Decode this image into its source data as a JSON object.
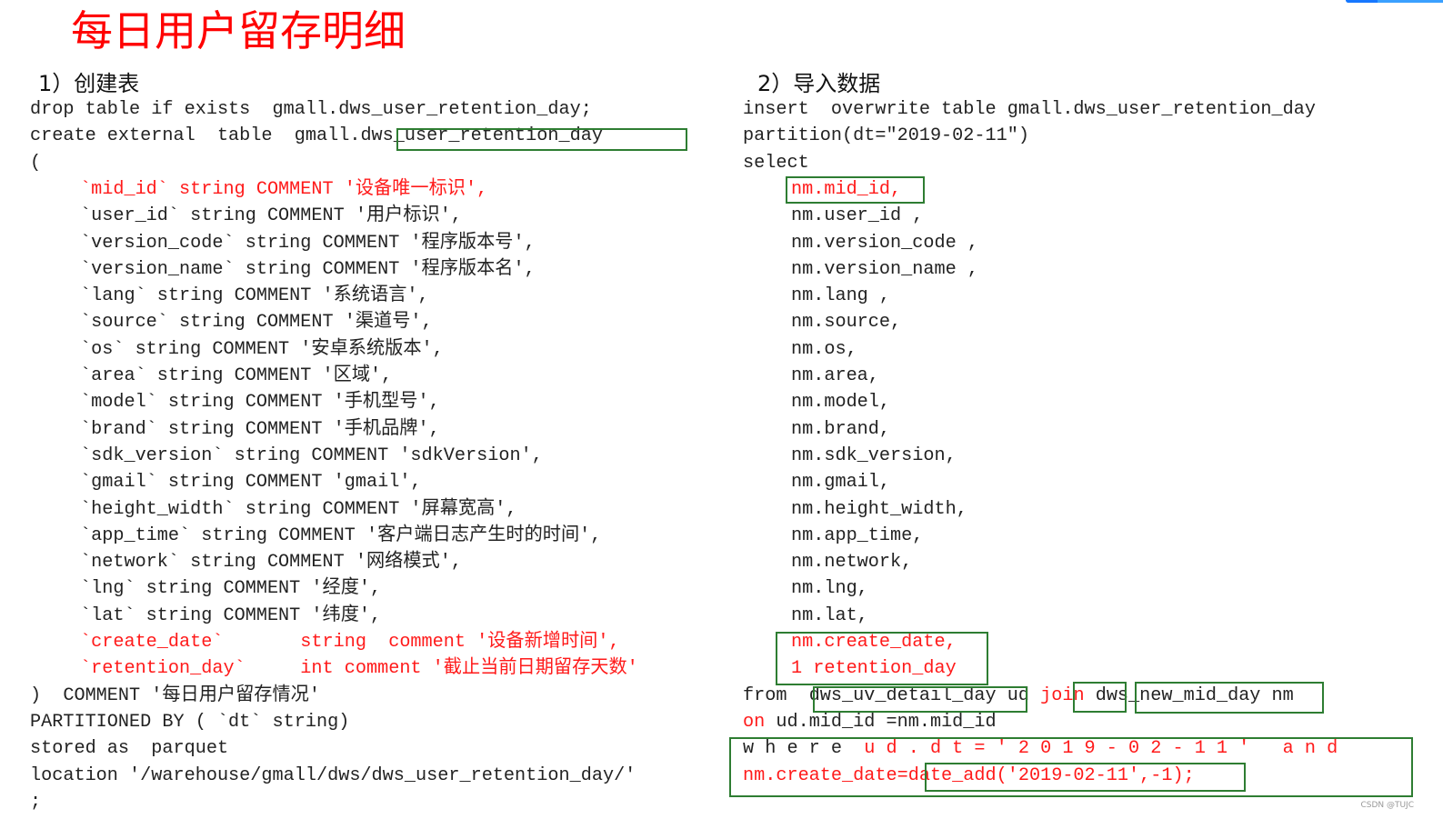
{
  "title": "每日用户留存明细",
  "watermark": "CSDN @TUJC",
  "colors": {
    "highlight_red": "#ff1a1a",
    "box_green": "#2e7d32",
    "title_red": "#ff0000"
  },
  "left": {
    "heading": "1）创建表",
    "lines": [
      {
        "indent": 0,
        "segments": [
          {
            "t": "drop table if exists  gmall.dws_user_retention_day;"
          }
        ]
      },
      {
        "indent": 0,
        "segments": [
          {
            "t": "create external  table  gmall."
          },
          {
            "t": "dws_user_retention_day"
          }
        ]
      },
      {
        "indent": 0,
        "segments": [
          {
            "t": "("
          }
        ]
      },
      {
        "indent": 1,
        "segments": [
          {
            "t": "`mid_id` string COMMENT '设备唯一标识',",
            "red": true
          }
        ]
      },
      {
        "indent": 1,
        "segments": [
          {
            "t": "`user_id` string COMMENT '用户标识',"
          }
        ]
      },
      {
        "indent": 1,
        "segments": [
          {
            "t": "`version_code` string COMMENT '程序版本号',"
          }
        ]
      },
      {
        "indent": 1,
        "segments": [
          {
            "t": "`version_name` string COMMENT '程序版本名',"
          }
        ]
      },
      {
        "indent": 1,
        "segments": [
          {
            "t": "`lang` string COMMENT '系统语言',"
          }
        ]
      },
      {
        "indent": 1,
        "segments": [
          {
            "t": "`source` string COMMENT '渠道号',"
          }
        ]
      },
      {
        "indent": 1,
        "segments": [
          {
            "t": "`os` string COMMENT '安卓系统版本',"
          }
        ]
      },
      {
        "indent": 1,
        "segments": [
          {
            "t": "`area` string COMMENT '区域',"
          }
        ]
      },
      {
        "indent": 1,
        "segments": [
          {
            "t": "`model` string COMMENT '手机型号',"
          }
        ]
      },
      {
        "indent": 1,
        "segments": [
          {
            "t": "`brand` string COMMENT '手机品牌',"
          }
        ]
      },
      {
        "indent": 1,
        "segments": [
          {
            "t": "`sdk_version` string COMMENT 'sdkVersion',"
          }
        ]
      },
      {
        "indent": 1,
        "segments": [
          {
            "t": "`gmail` string COMMENT 'gmail',"
          }
        ]
      },
      {
        "indent": 1,
        "segments": [
          {
            "t": "`height_width` string COMMENT '屏幕宽高',"
          }
        ]
      },
      {
        "indent": 1,
        "segments": [
          {
            "t": "`app_time` string COMMENT '客户端日志产生时的时间',"
          }
        ]
      },
      {
        "indent": 1,
        "segments": [
          {
            "t": "`network` string COMMENT '网络模式',"
          }
        ]
      },
      {
        "indent": 1,
        "segments": [
          {
            "t": "`lng` string COMMENT '经度',"
          }
        ]
      },
      {
        "indent": 1,
        "segments": [
          {
            "t": "`lat` string COMMENT '纬度',"
          }
        ]
      },
      {
        "indent": 1,
        "segments": [
          {
            "t": "`create_date`       string  comment '设备新增时间',",
            "red": true
          }
        ]
      },
      {
        "indent": 1,
        "segments": [
          {
            "t": "`retention_day`     int comment '截止当前日期留存天数'",
            "red": true
          }
        ]
      },
      {
        "indent": 0,
        "segments": [
          {
            "t": ")  COMMENT '每日用户留存情况'"
          }
        ]
      },
      {
        "indent": 0,
        "segments": [
          {
            "t": "PARTITIONED BY ( `dt` string)"
          }
        ]
      },
      {
        "indent": 0,
        "segments": [
          {
            "t": "stored as  parquet"
          }
        ]
      },
      {
        "indent": 0,
        "segments": [
          {
            "t": "location '/warehouse/gmall/dws/dws_user_retention_day/'"
          }
        ]
      },
      {
        "indent": 0,
        "segments": [
          {
            "t": ";"
          }
        ]
      }
    ]
  },
  "right": {
    "heading": "2）导入数据",
    "lines": [
      {
        "indent": 0,
        "segments": [
          {
            "t": "insert  overwrite table gmall.dws_user_retention_day"
          }
        ]
      },
      {
        "indent": 0,
        "segments": [
          {
            "t": "partition(dt=\"2019-02-11\")"
          }
        ]
      },
      {
        "indent": 0,
        "segments": [
          {
            "t": "select"
          }
        ]
      },
      {
        "indent": 1,
        "segments": [
          {
            "t": "nm.mid_id,",
            "red": true
          }
        ]
      },
      {
        "indent": 1,
        "segments": [
          {
            "t": "nm.user_id ,"
          }
        ]
      },
      {
        "indent": 1,
        "segments": [
          {
            "t": "nm.version_code ,"
          }
        ]
      },
      {
        "indent": 1,
        "segments": [
          {
            "t": "nm.version_name ,"
          }
        ]
      },
      {
        "indent": 1,
        "segments": [
          {
            "t": "nm.lang ,"
          }
        ]
      },
      {
        "indent": 1,
        "segments": [
          {
            "t": "nm.source,"
          }
        ]
      },
      {
        "indent": 1,
        "segments": [
          {
            "t": "nm.os,"
          }
        ]
      },
      {
        "indent": 1,
        "segments": [
          {
            "t": "nm.area,"
          }
        ]
      },
      {
        "indent": 1,
        "segments": [
          {
            "t": "nm.model,"
          }
        ]
      },
      {
        "indent": 1,
        "segments": [
          {
            "t": "nm.brand,"
          }
        ]
      },
      {
        "indent": 1,
        "segments": [
          {
            "t": "nm.sdk_version,"
          }
        ]
      },
      {
        "indent": 1,
        "segments": [
          {
            "t": "nm.gmail,"
          }
        ]
      },
      {
        "indent": 1,
        "segments": [
          {
            "t": "nm.height_width,"
          }
        ]
      },
      {
        "indent": 1,
        "segments": [
          {
            "t": "nm.app_time,"
          }
        ]
      },
      {
        "indent": 1,
        "segments": [
          {
            "t": "nm.network,"
          }
        ]
      },
      {
        "indent": 1,
        "segments": [
          {
            "t": "nm.lng,"
          }
        ]
      },
      {
        "indent": 1,
        "segments": [
          {
            "t": "nm.lat,"
          }
        ]
      },
      {
        "indent": 1,
        "segments": [
          {
            "t": "nm.create_date,",
            "red": true
          }
        ]
      },
      {
        "indent": 1,
        "segments": [
          {
            "t": "1 retention_day",
            "red": true
          }
        ]
      },
      {
        "indent": 0,
        "segments": [
          {
            "t": "from  "
          },
          {
            "t": "dws_uv_detail_day"
          },
          {
            "t": " ud "
          },
          {
            "t": "join",
            "red": true
          },
          {
            "t": " "
          },
          {
            "t": "dws_new_mid_day"
          },
          {
            "t": " nm"
          }
        ]
      },
      {
        "indent": 0,
        "segments": [
          {
            "t": "on",
            "red": true
          },
          {
            "t": " ud.mid_id =nm.mid_id"
          }
        ]
      },
      {
        "indent": 0,
        "segments": [
          {
            "t": "w h e r e  "
          },
          {
            "t": "u d . d t = ' 2 0 1 9 - 0 2 - 1 1 '   a n d",
            "red": true
          }
        ]
      },
      {
        "indent": 0,
        "segments": [
          {
            "t": "nm.create_date=",
            "red": true
          },
          {
            "t": "date_add('2019-02-11',-1);",
            "red": true
          }
        ]
      }
    ]
  }
}
